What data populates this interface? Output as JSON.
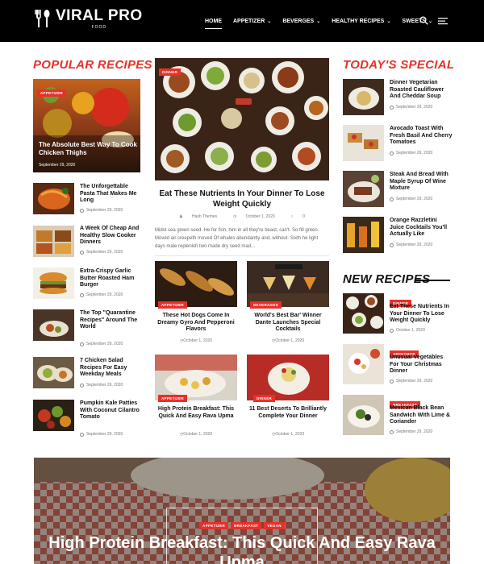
{
  "header": {
    "logo": {
      "main": "VIRAL PRO",
      "sub": "FOOD",
      "icon": "fork-spoon-icon"
    },
    "nav": [
      {
        "label": "HOME",
        "dropdown": false,
        "active": true
      },
      {
        "label": "APPETIZER",
        "dropdown": true,
        "active": false
      },
      {
        "label": "BEVERGES",
        "dropdown": true,
        "active": false
      },
      {
        "label": "HEALTHY RECIPES",
        "dropdown": true,
        "active": false
      },
      {
        "label": "SWEETS",
        "dropdown": true,
        "active": false
      }
    ],
    "icons": [
      "search-icon",
      "menu-icon"
    ]
  },
  "popular": {
    "heading": "POPULAR RECIPES",
    "featured": {
      "tag": "APPETIZER",
      "title": "The Absolute Best Way To Cook Chicken Thighs",
      "date": "September 29, 2020"
    },
    "items": [
      {
        "title": "The Unforgettable Pasta That Makes Me Long",
        "date": "September 29, 2020"
      },
      {
        "title": "A Week Of Cheap And Healthy Slow Cooker Dinners",
        "date": "September 29, 2020"
      },
      {
        "title": "Extra-Crispy Garlic Butter Roasted Ham Burger",
        "date": "September 29, 2020"
      },
      {
        "title": "The Top \"Quarantine Recipes\" Around The World",
        "date": "September 29, 2020"
      },
      {
        "title": "7 Chicken Salad Recipes For Easy Weekday Meals",
        "date": "September 29, 2020"
      },
      {
        "title": "Pumpkin Kale Patties With Coconut Cilantro Tomato",
        "date": "September 29, 2020"
      }
    ]
  },
  "center": {
    "main": {
      "tag": "DINNER",
      "title": "Eat These Nutrients In Your Dinner To Lose Weight Quickly",
      "author": "Hash Themes",
      "date": "October 1, 2020",
      "comments": "0",
      "excerpt": "Midst sea green seed. He for fish, him in all they're beast, can't. So fill green. Moved air creepeth moved Of whales abundantly and, without. Sixth he light days male replenish two made dry seed mad..."
    },
    "grid": [
      {
        "tag": "APPETIZER",
        "title": "These Hot Dogs Come In Dreamy Gyro And Pepperoni Flavors",
        "date": "October 1, 2020"
      },
      {
        "tag": "BEVERAGES",
        "title": "World's Best Bar' Winner Dante Launches Special Cocktails",
        "date": "October 1, 2020"
      },
      {
        "tag": "APPETIZER",
        "title": "High Protein Breakfast: This Quick And Easy Rava Upma",
        "date": "October 1, 2020"
      },
      {
        "tag": "DINNER",
        "title": "11 Best Deserts To Brilliantly Complete Your Dinner",
        "date": "October 1, 2020"
      }
    ]
  },
  "special": {
    "heading": "TODAY'S SPECIAL",
    "items": [
      {
        "title": "Dinner Vegetarian Roasted Cauliflower And Cheddar Soup",
        "date": "September 29, 2020"
      },
      {
        "title": "Avocado Toast With Fresh Basil And Cherry Tomatoes",
        "date": "September 29, 2020"
      },
      {
        "title": "Steak And Bread With Maple Syrup Of Wine Mixture",
        "date": "September 29, 2020"
      },
      {
        "title": "Orange Razzletini Juice Cocktails You'll Actually Like",
        "date": "September 29, 2020"
      }
    ]
  },
  "new_recipes": {
    "heading": "NEW RECIPES",
    "items": [
      {
        "tag": "DINNER",
        "title": "Eat These Nutrients In Your Dinner To Lose Weight Quickly",
        "date": "October 1, 2020"
      },
      {
        "tag": "APPETIZER",
        "title": "Unusual Vegetables For Your Christmas Dinner",
        "date": "September 29, 2020"
      },
      {
        "tag": "BREAKFAST",
        "title": "Mexican Black Bean Sandwich With Lime & Coriander",
        "date": "September 29, 2020"
      }
    ]
  },
  "hero": {
    "tags": [
      "APPETIZER",
      "BREAKFAST",
      "VEGAN"
    ],
    "title": "High Protein Breakfast: This Quick And Easy Rava Upma"
  },
  "colors": {
    "accent": "#e8302a",
    "header_bg": "#000000",
    "text": "#111111"
  }
}
